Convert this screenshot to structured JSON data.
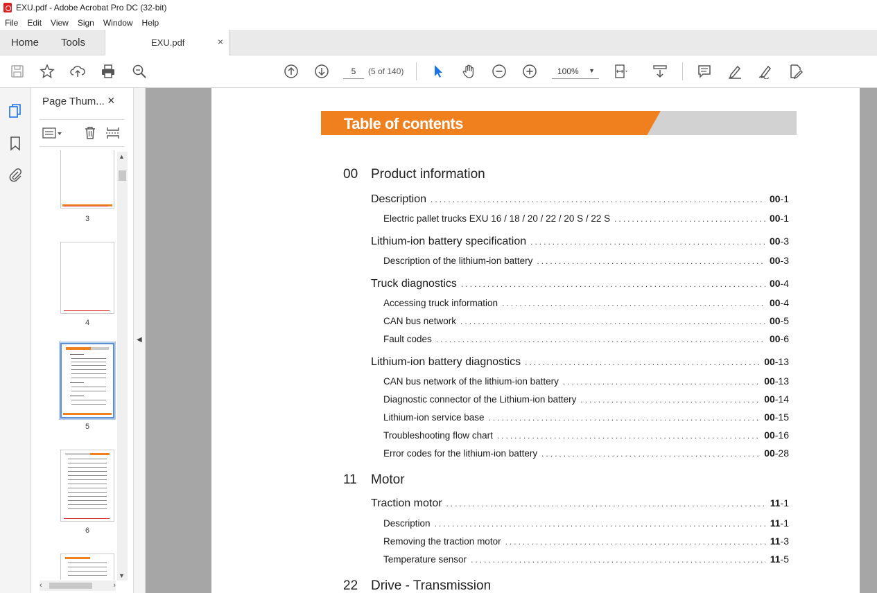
{
  "window": {
    "title": "EXU.pdf - Adobe Acrobat Pro DC (32-bit)"
  },
  "menu": [
    "File",
    "Edit",
    "View",
    "Sign",
    "Window",
    "Help"
  ],
  "tabs": {
    "home": "Home",
    "tools": "Tools",
    "document": "EXU.pdf",
    "close": "×"
  },
  "toolbar": {
    "page_number": "5",
    "page_count": "(5 of 140)",
    "zoom": "100%"
  },
  "thumbnails": {
    "title": "Page Thum...",
    "close": "×",
    "pages": [
      "3",
      "4",
      "5",
      "6"
    ],
    "selected": "5"
  },
  "document": {
    "banner_title": "Table of contents",
    "sections": [
      {
        "num": "00",
        "title": "Product information"
      },
      {
        "num": "11",
        "title": "Motor"
      },
      {
        "num": "22",
        "title": "Drive - Transmission"
      }
    ],
    "entries": [
      {
        "text": "Description",
        "chap": "00",
        "page": "-1",
        "level": 1
      },
      {
        "text": "Electric pallet trucks EXU 16 / 18 / 20 / 22 / 20 S / 22 S",
        "chap": "00",
        "page": "-1",
        "level": 2
      },
      {
        "text": "Lithium-ion battery specification",
        "chap": "00",
        "page": "-3",
        "level": 1
      },
      {
        "text": "Description of the lithium-ion battery",
        "chap": "00",
        "page": "-3",
        "level": 2
      },
      {
        "text": "Truck diagnostics",
        "chap": "00",
        "page": "-4",
        "level": 1
      },
      {
        "text": "Accessing truck information",
        "chap": "00",
        "page": "-4",
        "level": 2
      },
      {
        "text": "CAN bus network",
        "chap": "00",
        "page": "-5",
        "level": 2
      },
      {
        "text": "Fault codes",
        "chap": "00",
        "page": "-6",
        "level": 2
      },
      {
        "text": "Lithium-ion battery diagnostics",
        "chap": "00",
        "page": "-13",
        "level": 1
      },
      {
        "text": "CAN bus network of the lithium-ion battery",
        "chap": "00",
        "page": "-13",
        "level": 2
      },
      {
        "text": "Diagnostic connector of the Lithium-ion battery",
        "chap": "00",
        "page": "-14",
        "level": 2
      },
      {
        "text": "Lithium-ion service base",
        "chap": "00",
        "page": "-15",
        "level": 2
      },
      {
        "text": "Troubleshooting flow chart",
        "chap": "00",
        "page": "-16",
        "level": 2
      },
      {
        "text": "Error codes for the lithium-ion battery",
        "chap": "00",
        "page": "-28",
        "level": 2
      },
      {
        "text": "Traction motor",
        "chap": "11",
        "page": "-1",
        "level": 1
      },
      {
        "text": "Description",
        "chap": "11",
        "page": "-1",
        "level": 2
      },
      {
        "text": "Removing the traction motor",
        "chap": "11",
        "page": "-3",
        "level": 2
      },
      {
        "text": "Temperature sensor",
        "chap": "11",
        "page": "-5",
        "level": 2
      }
    ]
  },
  "colors": {
    "banner_orange": "#f07f1e",
    "banner_grey": "#d2d2d2",
    "selection_blue": "#5b8fd4",
    "cursor_blue": "#1a73e8"
  }
}
